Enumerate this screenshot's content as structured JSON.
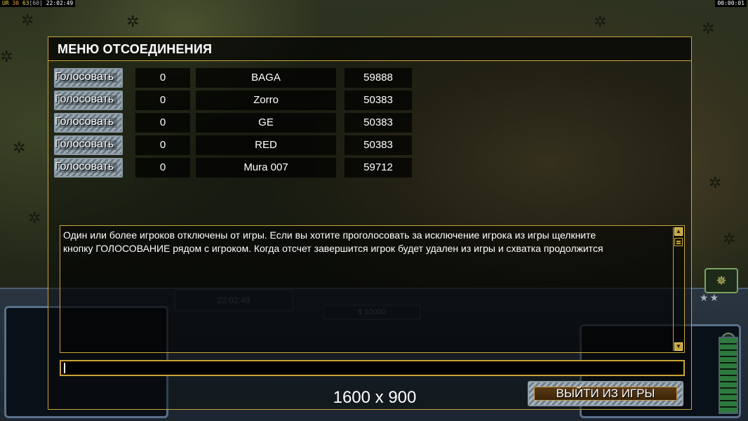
{
  "topbar": {
    "seg1": "UR",
    "seg2": "30",
    "seg3": "63",
    "seg4": "60",
    "clock": "22:02:49",
    "timer": "00:00:01"
  },
  "hud": {
    "time": "22:02:49",
    "money": "$ 10000"
  },
  "dialog": {
    "title": "МЕНЮ ОТСОЕДИНЕНИЯ",
    "players": [
      {
        "vote_label": "Голосовать",
        "votes": "0",
        "name": "BAGA",
        "ping": "59888"
      },
      {
        "vote_label": "Голосовать",
        "votes": "0",
        "name": "Zorro",
        "ping": "50383"
      },
      {
        "vote_label": "Голосовать",
        "votes": "0",
        "name": "GE",
        "ping": "50383"
      },
      {
        "vote_label": "Голосовать",
        "votes": "0",
        "name": "RED",
        "ping": "50383"
      },
      {
        "vote_label": "Голосовать",
        "votes": "0",
        "name": "Mura 007",
        "ping": "59712"
      }
    ],
    "message_lines": [
      "Один или более игроков отключены от игры. Если вы хотите проголосовать за исключение игрока из игры щелкните",
      " кнопку ГОЛОСОВАНИЕ рядом с игроком. Когда отсчет завершится игрок будет удален из игры и схватка продолжится"
    ],
    "chat_value": "",
    "resolution": "1600 x 900",
    "exit_label": "ВЫЙТИ ИЗ ИГРЫ"
  },
  "colors": {
    "frame_gold": "#c7a43a",
    "button_metal": "#8b9aa6",
    "cell_bg": "#000000"
  },
  "icons": {
    "scroll_up": "scroll-up-icon",
    "scroll_down": "scroll-down-icon",
    "radar": "radar-icon"
  }
}
